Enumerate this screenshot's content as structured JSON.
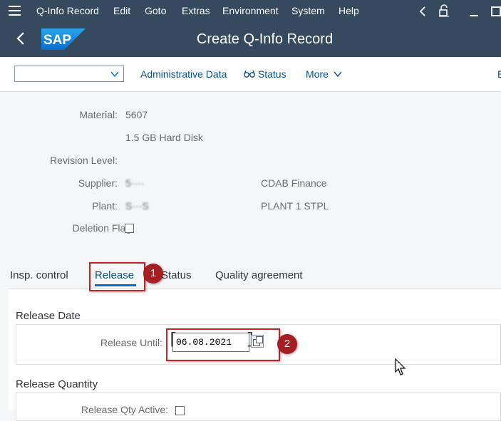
{
  "menu": {
    "items": [
      {
        "label": "Q-Info Record",
        "key": "Q"
      },
      {
        "label": "Edit",
        "key": "E"
      },
      {
        "label": "Goto",
        "key": "G"
      },
      {
        "label": "Extras",
        "key": "x"
      },
      {
        "label": "Environment",
        "key": "v"
      },
      {
        "label": "System",
        "key": "S"
      },
      {
        "label": "Help",
        "key": "H"
      }
    ]
  },
  "header": {
    "logo_text": "SAP",
    "title": "Create Q-Info Record"
  },
  "toolbar": {
    "dropdown_value": "",
    "administrative_data": "Administrative Data",
    "status": "Status",
    "more": "More",
    "overflow": "E"
  },
  "fields": {
    "material_label": "Material:",
    "material_value": "5607",
    "material_desc": "1.5 GB Hard Disk",
    "revision_label": "Revision Level:",
    "supplier_label": "Supplier:",
    "supplier_value": "5····",
    "supplier_name": "CDAB Finance",
    "plant_label": "Plant:",
    "plant_value": "S···S",
    "plant_name": "PLANT 1 STPL",
    "deletion_label": "Deletion Flag:"
  },
  "tabs": [
    {
      "label": "Insp. control"
    },
    {
      "label": "Release"
    },
    {
      "label": "Status"
    },
    {
      "label": "Quality agreement"
    }
  ],
  "release": {
    "date_section": "Release Date",
    "until_label": "Release Until:",
    "until_value": "06.08.2021",
    "quantity_section": "Release Quantity",
    "qty_active_label": "Release Qty Active:"
  },
  "callouts": {
    "one": "1",
    "two": "2"
  },
  "colors": {
    "shell": "#354a5f",
    "accent": "#0a6ed1",
    "callout": "#c0262c"
  }
}
